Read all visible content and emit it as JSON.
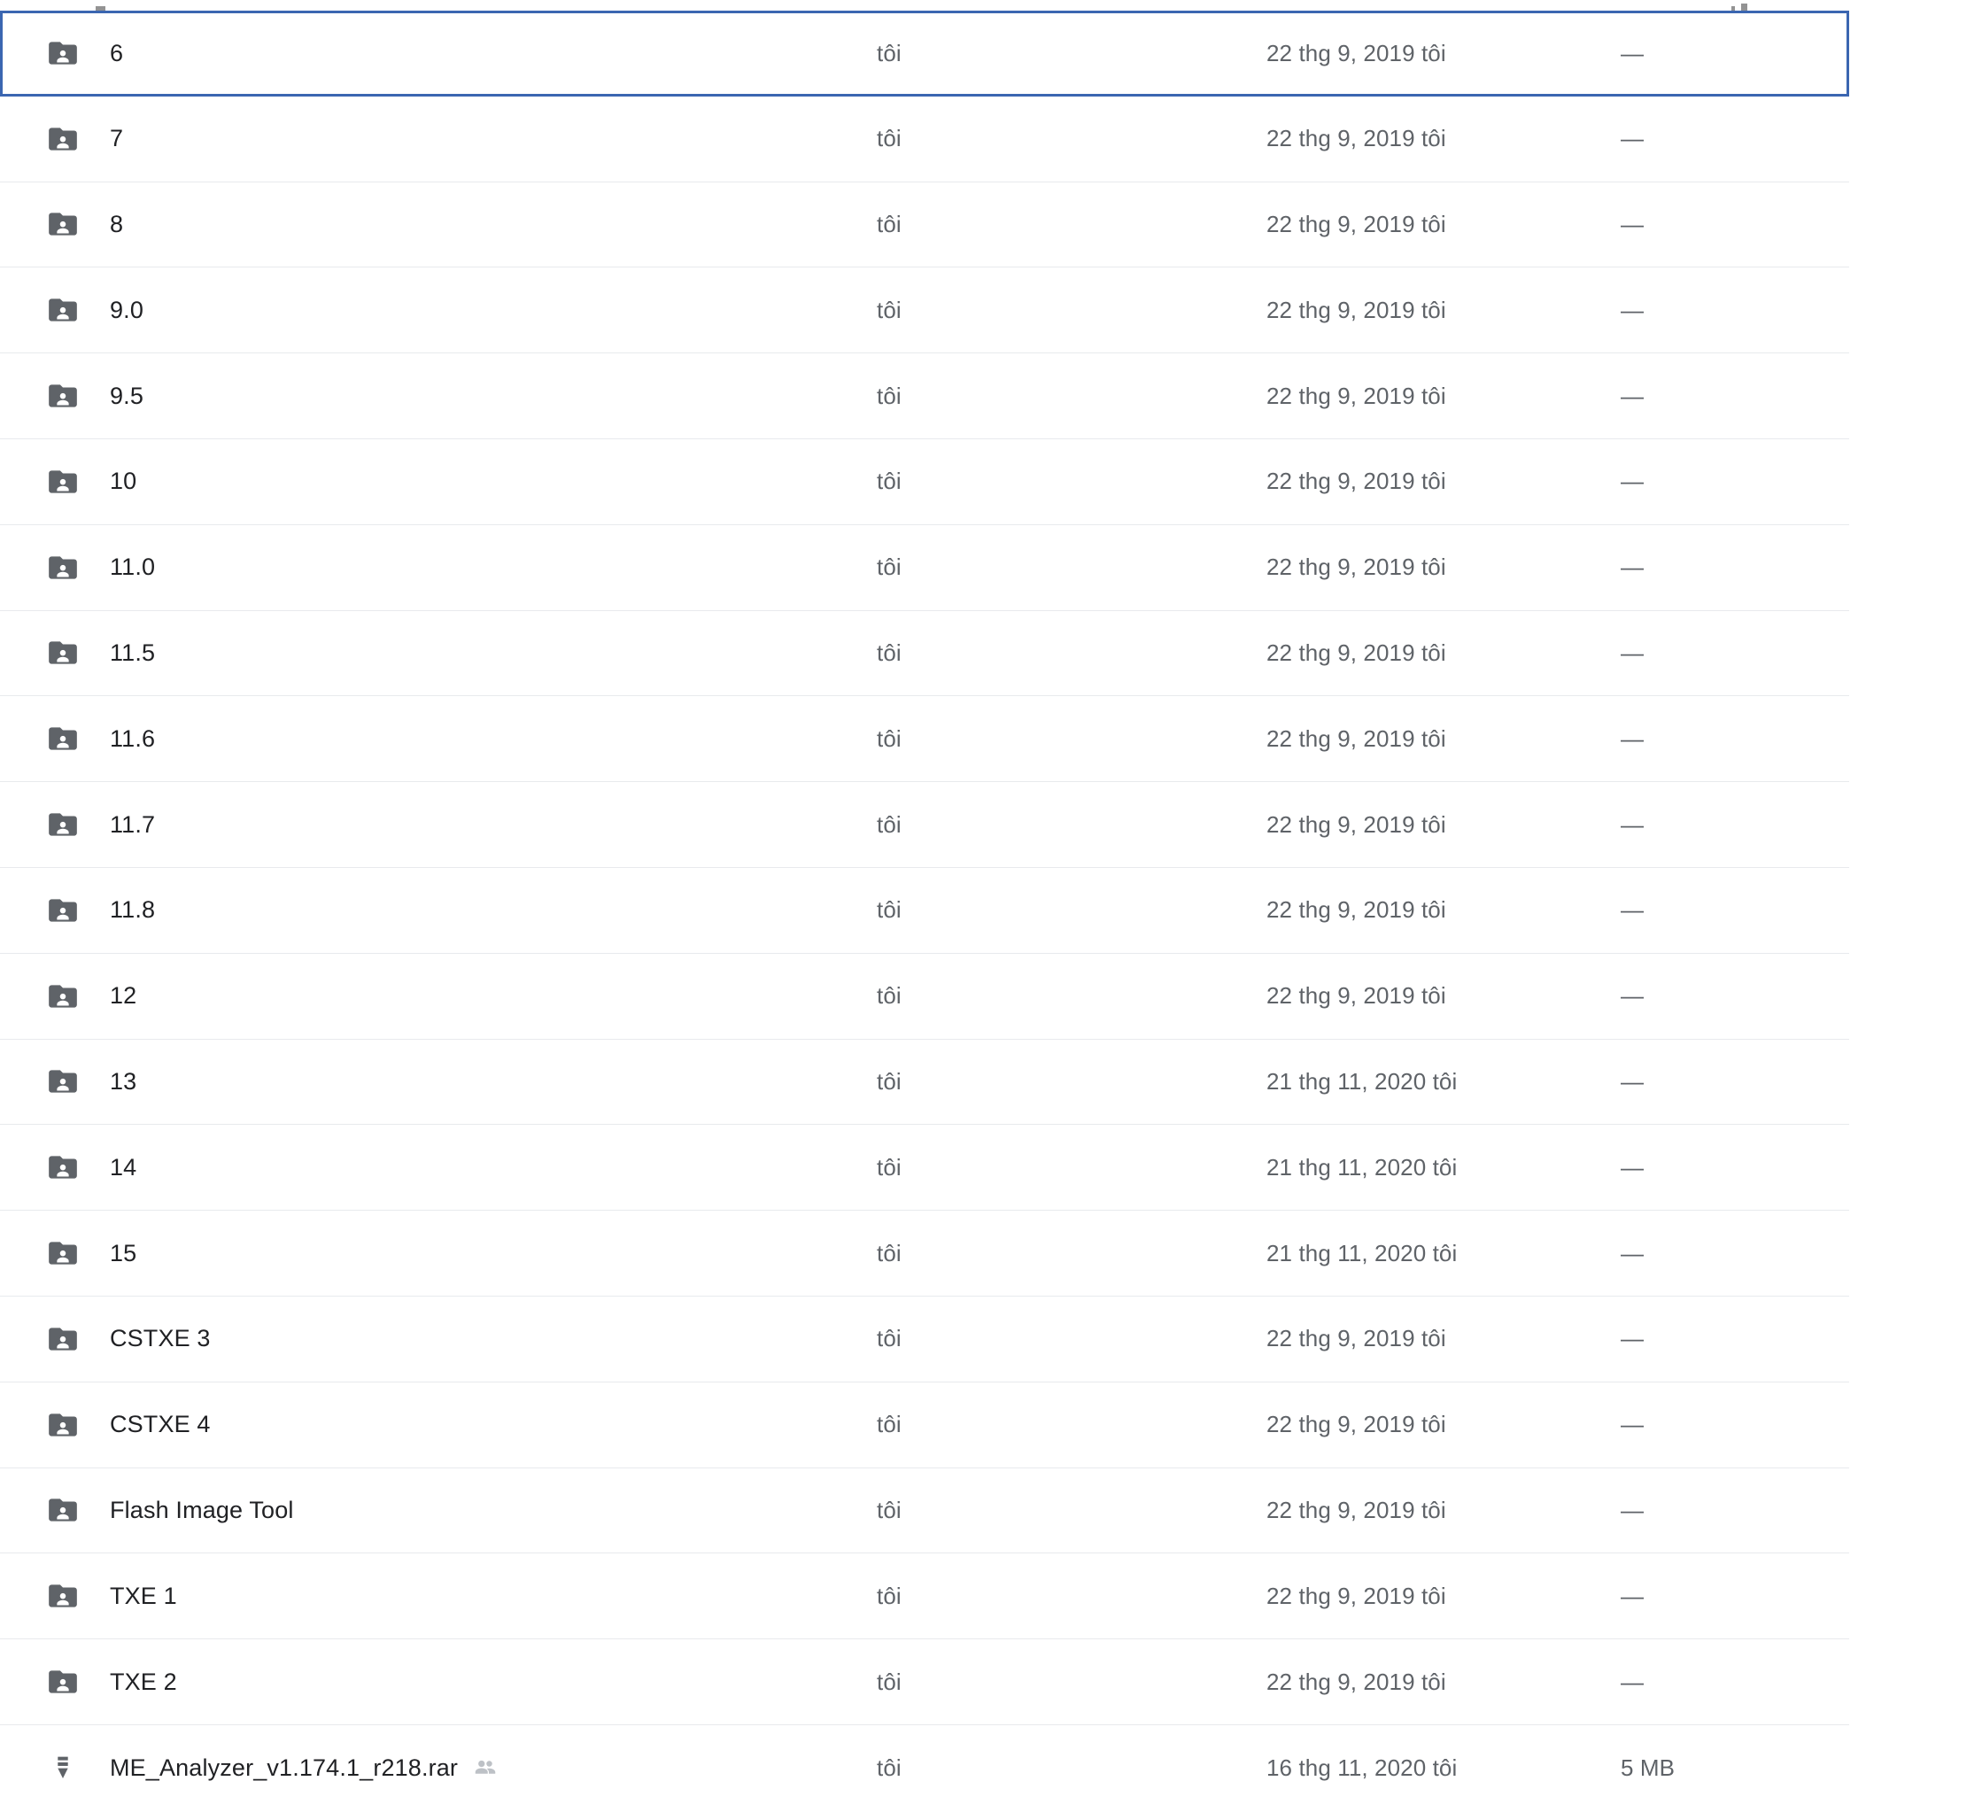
{
  "app": {
    "language": "vi",
    "view": "file-list",
    "accent_color": "#3b66b1",
    "text_primary": "#202124",
    "text_secondary": "#5f6368",
    "row_divider_color": "#e8eaed",
    "folder_icon_color": "#5f6368",
    "shared_icon_color": "#bdc1c6"
  },
  "columns": {
    "name": "",
    "owner": "",
    "modified": "",
    "size": ""
  },
  "rows": [
    {
      "name": "6",
      "icon": "shared-folder-icon",
      "owner": "tôi",
      "modified": "22 thg 9, 2019  tôi",
      "size": "—",
      "selected": true,
      "shared": false
    },
    {
      "name": "7",
      "icon": "shared-folder-icon",
      "owner": "tôi",
      "modified": "22 thg 9, 2019  tôi",
      "size": "—",
      "selected": false,
      "shared": false
    },
    {
      "name": "8",
      "icon": "shared-folder-icon",
      "owner": "tôi",
      "modified": "22 thg 9, 2019  tôi",
      "size": "—",
      "selected": false,
      "shared": false
    },
    {
      "name": "9.0",
      "icon": "shared-folder-icon",
      "owner": "tôi",
      "modified": "22 thg 9, 2019  tôi",
      "size": "—",
      "selected": false,
      "shared": false
    },
    {
      "name": "9.5",
      "icon": "shared-folder-icon",
      "owner": "tôi",
      "modified": "22 thg 9, 2019  tôi",
      "size": "—",
      "selected": false,
      "shared": false
    },
    {
      "name": "10",
      "icon": "shared-folder-icon",
      "owner": "tôi",
      "modified": "22 thg 9, 2019  tôi",
      "size": "—",
      "selected": false,
      "shared": false
    },
    {
      "name": "11.0",
      "icon": "shared-folder-icon",
      "owner": "tôi",
      "modified": "22 thg 9, 2019  tôi",
      "size": "—",
      "selected": false,
      "shared": false
    },
    {
      "name": "11.5",
      "icon": "shared-folder-icon",
      "owner": "tôi",
      "modified": "22 thg 9, 2019  tôi",
      "size": "—",
      "selected": false,
      "shared": false
    },
    {
      "name": "11.6",
      "icon": "shared-folder-icon",
      "owner": "tôi",
      "modified": "22 thg 9, 2019  tôi",
      "size": "—",
      "selected": false,
      "shared": false
    },
    {
      "name": "11.7",
      "icon": "shared-folder-icon",
      "owner": "tôi",
      "modified": "22 thg 9, 2019  tôi",
      "size": "—",
      "selected": false,
      "shared": false
    },
    {
      "name": "11.8",
      "icon": "shared-folder-icon",
      "owner": "tôi",
      "modified": "22 thg 9, 2019  tôi",
      "size": "—",
      "selected": false,
      "shared": false
    },
    {
      "name": "12",
      "icon": "shared-folder-icon",
      "owner": "tôi",
      "modified": "22 thg 9, 2019  tôi",
      "size": "—",
      "selected": false,
      "shared": false
    },
    {
      "name": "13",
      "icon": "shared-folder-icon",
      "owner": "tôi",
      "modified": "21 thg 11, 2020  tôi",
      "size": "—",
      "selected": false,
      "shared": false
    },
    {
      "name": "14",
      "icon": "shared-folder-icon",
      "owner": "tôi",
      "modified": "21 thg 11, 2020  tôi",
      "size": "—",
      "selected": false,
      "shared": false
    },
    {
      "name": "15",
      "icon": "shared-folder-icon",
      "owner": "tôi",
      "modified": "21 thg 11, 2020  tôi",
      "size": "—",
      "selected": false,
      "shared": false
    },
    {
      "name": "CSTXE 3",
      "icon": "shared-folder-icon",
      "owner": "tôi",
      "modified": "22 thg 9, 2019  tôi",
      "size": "—",
      "selected": false,
      "shared": false
    },
    {
      "name": "CSTXE 4",
      "icon": "shared-folder-icon",
      "owner": "tôi",
      "modified": "22 thg 9, 2019  tôi",
      "size": "—",
      "selected": false,
      "shared": false
    },
    {
      "name": "Flash Image Tool",
      "icon": "shared-folder-icon",
      "owner": "tôi",
      "modified": "22 thg 9, 2019  tôi",
      "size": "—",
      "selected": false,
      "shared": false
    },
    {
      "name": "TXE 1",
      "icon": "shared-folder-icon",
      "owner": "tôi",
      "modified": "22 thg 9, 2019  tôi",
      "size": "—",
      "selected": false,
      "shared": false
    },
    {
      "name": "TXE 2",
      "icon": "shared-folder-icon",
      "owner": "tôi",
      "modified": "22 thg 9, 2019  tôi",
      "size": "—",
      "selected": false,
      "shared": false
    },
    {
      "name": "ME_Analyzer_v1.174.1_r218.rar",
      "icon": "archive-file-icon",
      "owner": "tôi",
      "modified": "16 thg 11, 2020  tôi",
      "size": "5 MB",
      "selected": false,
      "shared": true
    }
  ]
}
